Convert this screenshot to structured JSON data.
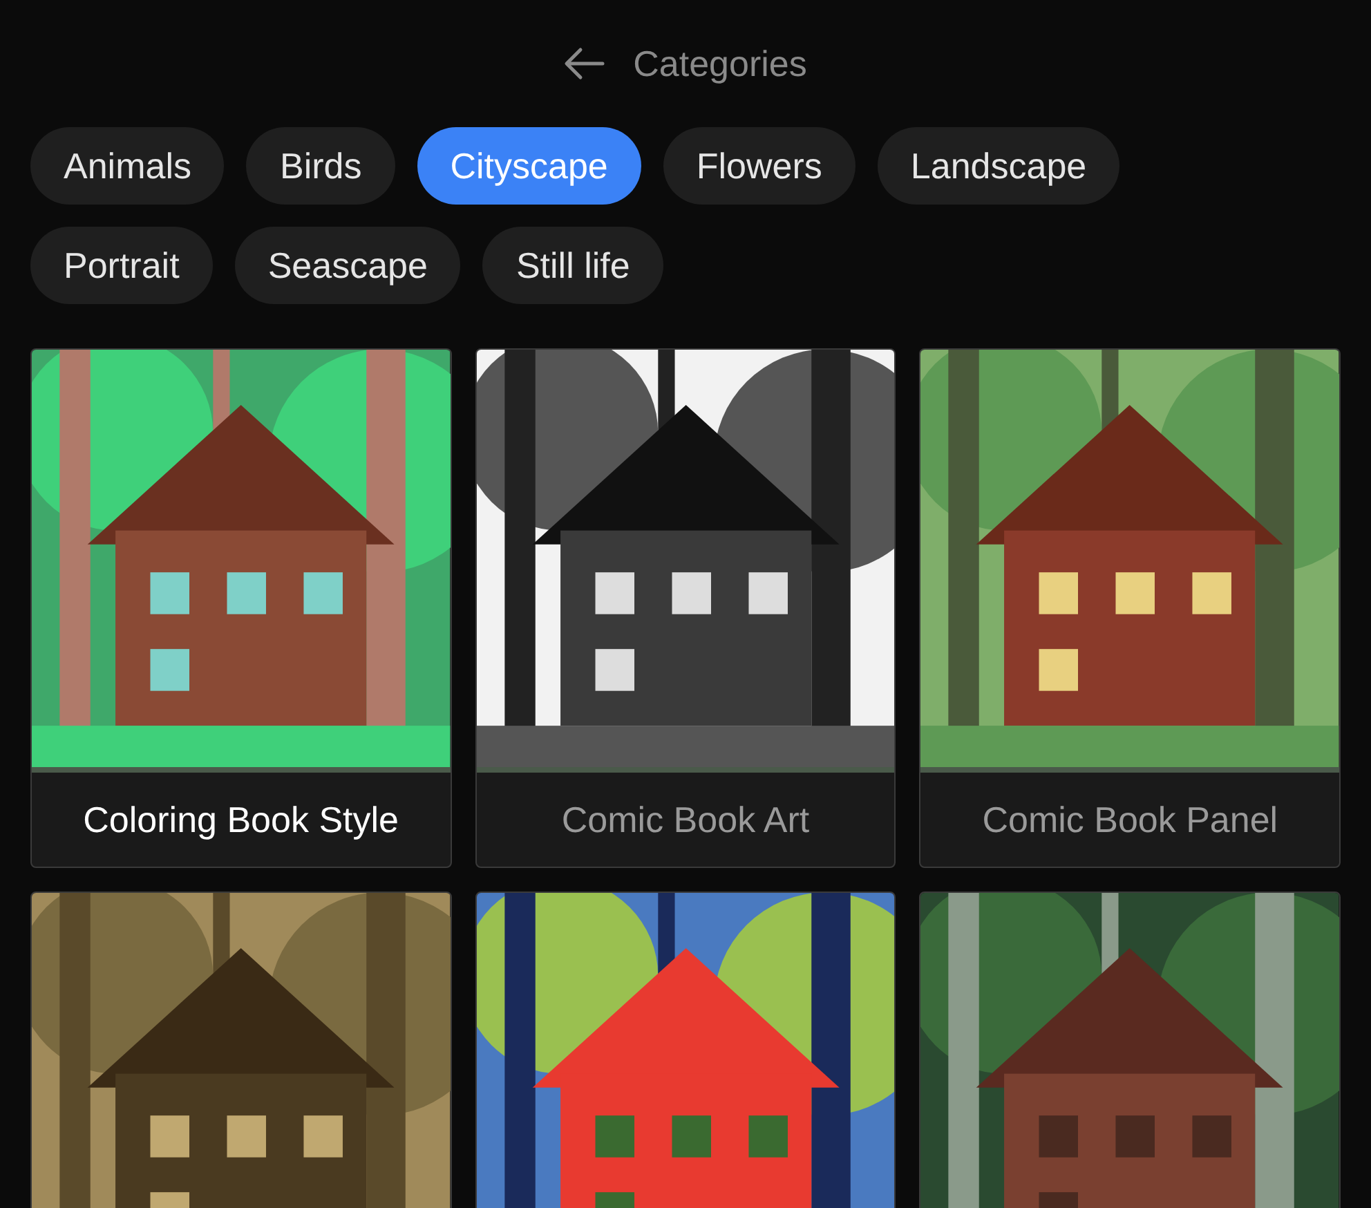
{
  "header": {
    "title": "Categories"
  },
  "categories": [
    {
      "label": "Animals",
      "selected": false
    },
    {
      "label": "Birds",
      "selected": false
    },
    {
      "label": "Cityscape",
      "selected": true
    },
    {
      "label": "Flowers",
      "selected": false
    },
    {
      "label": "Landscape",
      "selected": false
    },
    {
      "label": "Portrait",
      "selected": false
    },
    {
      "label": "Seascape",
      "selected": false
    },
    {
      "label": "Still life",
      "selected": false
    }
  ],
  "styles": [
    {
      "title": "Coloring Book Style",
      "selected": true
    },
    {
      "title": "Comic Book Art",
      "selected": false
    },
    {
      "title": "Comic Book Panel",
      "selected": false
    },
    {
      "kind": "picture"
    },
    {
      "kind": "picture"
    },
    {
      "kind": "picture"
    }
  ]
}
